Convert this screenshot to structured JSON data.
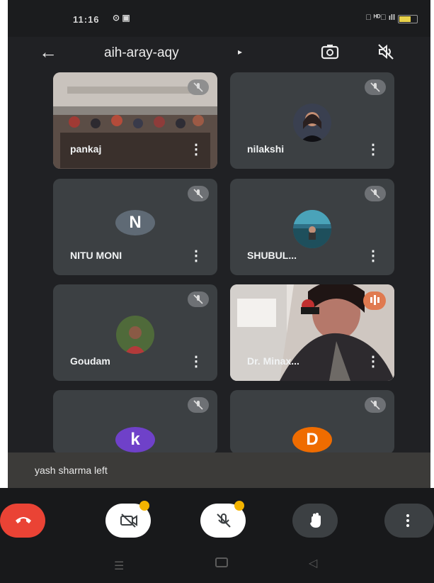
{
  "status_bar": {
    "time": "11:16",
    "left_icons": "⊙ ▣",
    "right_icons": "⧈ ᴴᴰ᳟ ıll"
  },
  "header": {
    "meeting_code": "aih-aray-aqy",
    "code_arrow": "▸"
  },
  "tiles": [
    {
      "name": "pankaj",
      "type": "video",
      "muted": true
    },
    {
      "name": "nilakshi",
      "type": "photo",
      "muted": true
    },
    {
      "name": "NITU MONI",
      "type": "letter",
      "letter": "N",
      "avatar_color": "#5f6a75",
      "muted": true
    },
    {
      "name": "SHUBUL...",
      "type": "photo",
      "muted": true
    },
    {
      "name": "Goudam",
      "type": "photo",
      "muted": true
    },
    {
      "name": "Dr. Minax...",
      "type": "video",
      "speaking": true
    },
    {
      "name": "",
      "type": "letter",
      "letter": "k",
      "avatar_color": "#6f41c9",
      "muted": true
    },
    {
      "name": "",
      "type": "letter",
      "letter": "D",
      "avatar_color": "#ef6c00",
      "muted": true
    }
  ],
  "toast": {
    "message": "yash sharma left"
  },
  "colors": {
    "end_call": "#ea4335",
    "notification": "#f4b400",
    "background": "#202124"
  },
  "icons": {
    "back": "arrow-left-icon",
    "switch_camera": "switch-camera-icon",
    "speaker": "speaker-off-icon",
    "tile_menu": "more-vert-icon",
    "mic": "mic-off-icon",
    "camera": "camera-off-icon",
    "hand": "raise-hand-icon",
    "end_call": "end-call-icon"
  },
  "tile_menu_glyph": "⋮"
}
